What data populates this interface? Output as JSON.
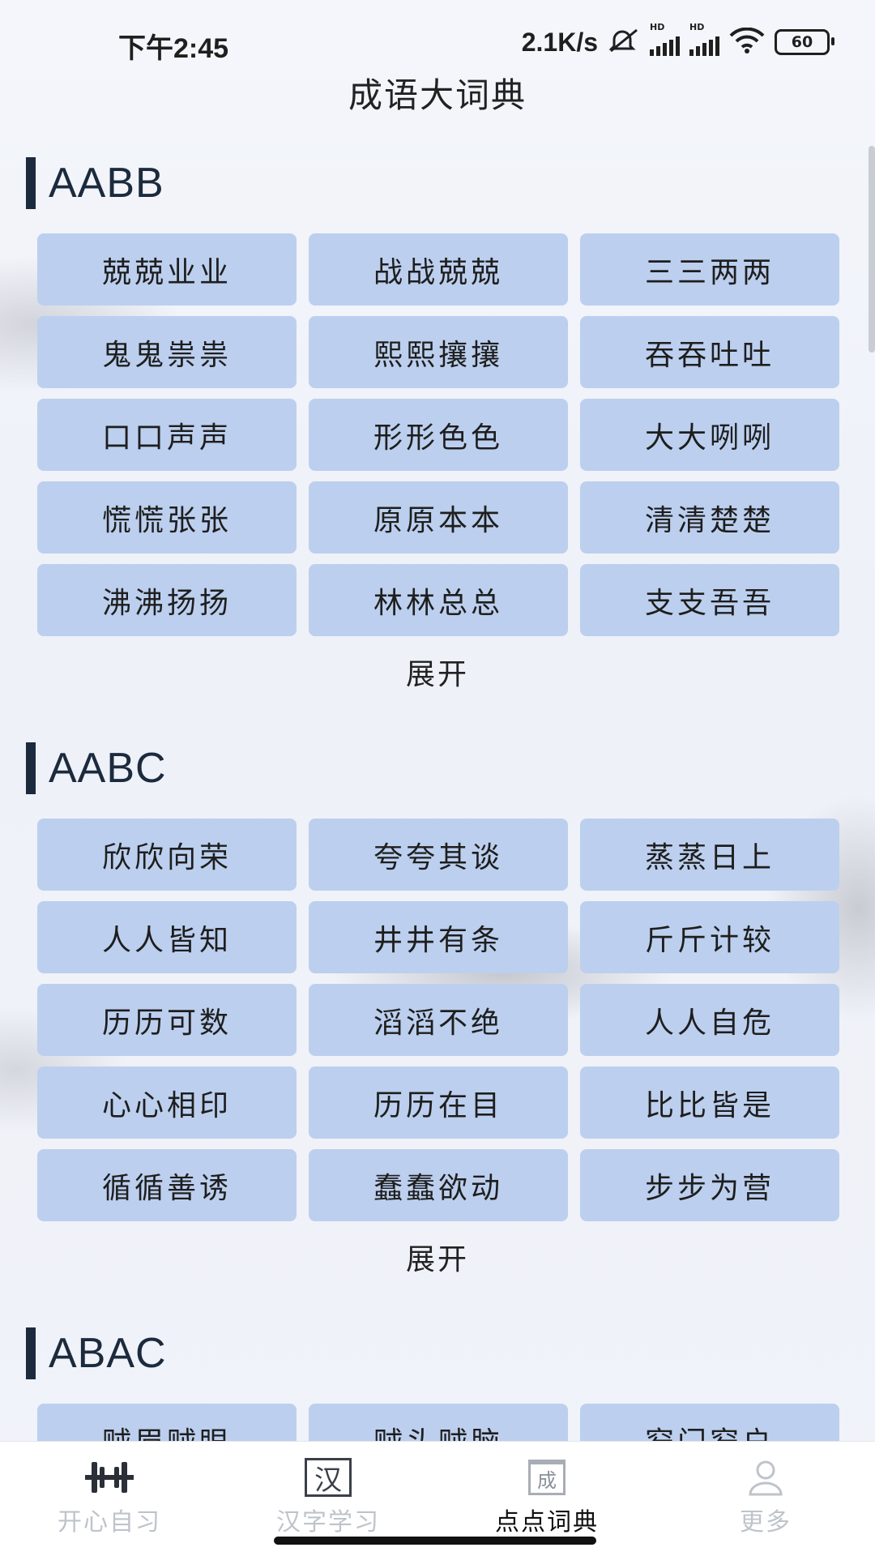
{
  "status_bar": {
    "time": "下午2:45",
    "net_speed": "2.1K/s",
    "battery": "60",
    "hd_label": "HD"
  },
  "page_title": "成语大词典",
  "sections": [
    {
      "title": "AABB",
      "items": [
        "兢兢业业",
        "战战兢兢",
        "三三两两",
        "鬼鬼祟祟",
        "熙熙攘攘",
        "吞吞吐吐",
        "口口声声",
        "形形色色",
        "大大咧咧",
        "慌慌张张",
        "原原本本",
        "清清楚楚",
        "沸沸扬扬",
        "林林总总",
        "支支吾吾"
      ],
      "expand_label": "展开"
    },
    {
      "title": "AABC",
      "items": [
        "欣欣向荣",
        "夸夸其谈",
        "蒸蒸日上",
        "人人皆知",
        "井井有条",
        "斤斤计较",
        "历历可数",
        "滔滔不绝",
        "人人自危",
        "心心相印",
        "历历在目",
        "比比皆是",
        "循循善诱",
        "蠢蠢欲动",
        "步步为营"
      ],
      "expand_label": "展开"
    },
    {
      "title": "ABAC",
      "items": [
        "贼眉贼眼",
        "贼头贼脑",
        "窄门窄户"
      ]
    }
  ],
  "tabs": [
    {
      "label": "开心自习",
      "icon": "barbell-icon",
      "active": false
    },
    {
      "label": "汉字学习",
      "icon_char": "汉",
      "active": false
    },
    {
      "label": "点点词典",
      "icon_char": "成",
      "active": true
    },
    {
      "label": "更多",
      "icon": "user-icon",
      "active": false
    }
  ],
  "colors": {
    "chip_bg": "#bccfee",
    "section_bar": "#1c2a3d",
    "tab_inactive": "#bfc3ca",
    "tab_active": "#111111"
  }
}
